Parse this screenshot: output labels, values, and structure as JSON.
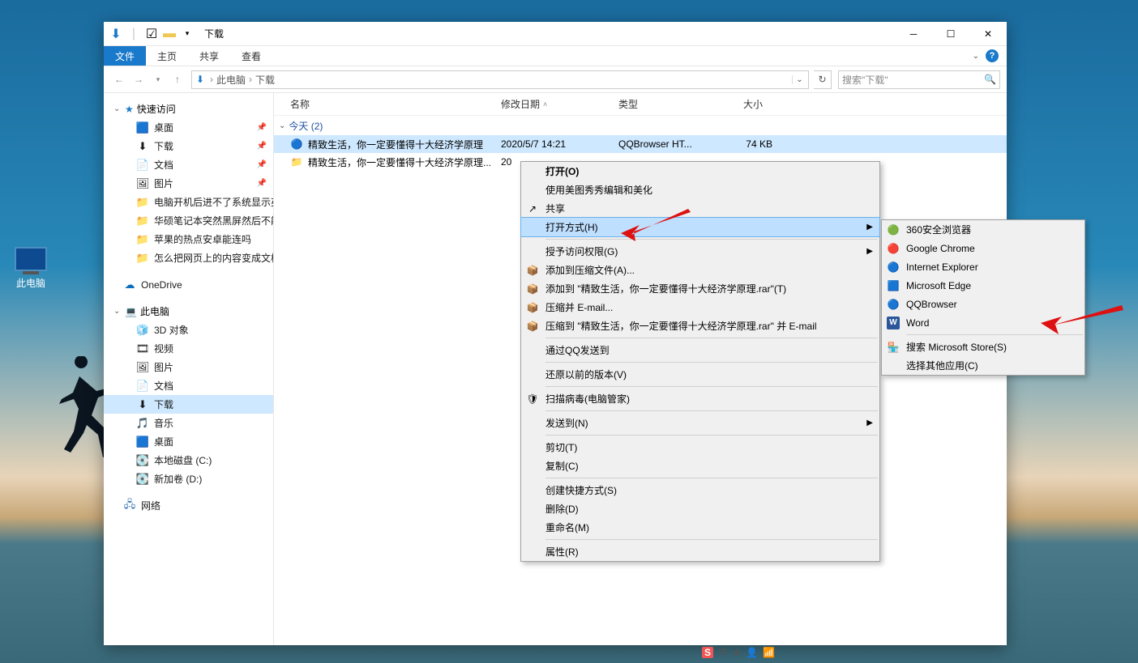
{
  "desktop": {
    "pc_label": "此电脑"
  },
  "titlebar": {
    "title": "下载"
  },
  "ribbon": {
    "file": "文件",
    "home": "主页",
    "share": "共享",
    "view": "查看"
  },
  "nav": {
    "crumbs": [
      "此电脑",
      "下载"
    ],
    "search_placeholder": "搜索\"下载\""
  },
  "sidebar": {
    "quick": {
      "label": "快速访问",
      "items": [
        {
          "label": "桌面",
          "icon": "🟦",
          "pin": true
        },
        {
          "label": "下载",
          "icon": "⬇",
          "pin": true
        },
        {
          "label": "文档",
          "icon": "📄",
          "pin": true
        },
        {
          "label": "图片",
          "icon": "🖼",
          "pin": true
        },
        {
          "label": "电脑开机后进不了系统显示英文",
          "icon": "📁"
        },
        {
          "label": "华硕笔记本突然黑屏然后不能开",
          "icon": "📁"
        },
        {
          "label": "苹果的热点安卓能连吗",
          "icon": "📁"
        },
        {
          "label": "怎么把网页上的内容变成文档",
          "icon": "📁"
        }
      ]
    },
    "onedrive": "OneDrive",
    "thispc": {
      "label": "此电脑",
      "items": [
        {
          "label": "3D 对象",
          "icon": "🧊"
        },
        {
          "label": "视频",
          "icon": "🎞"
        },
        {
          "label": "图片",
          "icon": "🖼"
        },
        {
          "label": "文档",
          "icon": "📄"
        },
        {
          "label": "下载",
          "icon": "⬇",
          "selected": true
        },
        {
          "label": "音乐",
          "icon": "🎵"
        },
        {
          "label": "桌面",
          "icon": "🟦"
        },
        {
          "label": "本地磁盘 (C:)",
          "icon": "💽"
        },
        {
          "label": "新加卷 (D:)",
          "icon": "💽"
        }
      ]
    },
    "network": "网络"
  },
  "columns": {
    "name": "名称",
    "date": "修改日期",
    "type": "类型",
    "size": "大小"
  },
  "group": {
    "label": "今天 (2)"
  },
  "files": [
    {
      "name": "精致生活，你一定要懂得十大经济学原理",
      "date": "2020/5/7 14:21",
      "type": "QQBrowser HT...",
      "size": "74 KB",
      "icon": "🔵",
      "selected": true
    },
    {
      "name": "精致生活，你一定要懂得十大经济学原理...",
      "date": "20",
      "type": "",
      "size": "",
      "icon": "📁"
    }
  ],
  "ctx": {
    "items": [
      {
        "t": "打开(O)",
        "bold": true
      },
      {
        "t": "使用美图秀秀编辑和美化"
      },
      {
        "t": "共享",
        "icon": "↗"
      },
      {
        "t": "打开方式(H)",
        "sub": true,
        "hl": true
      },
      {
        "sep": true
      },
      {
        "t": "授予访问权限(G)",
        "sub": true
      },
      {
        "t": "添加到压缩文件(A)...",
        "icon": "📦"
      },
      {
        "t": "添加到 \"精致生活，你一定要懂得十大经济学原理.rar\"(T)",
        "icon": "📦"
      },
      {
        "t": "压缩并 E-mail...",
        "icon": "📦"
      },
      {
        "t": "压缩到 \"精致生活，你一定要懂得十大经济学原理.rar\" 并 E-mail",
        "icon": "📦"
      },
      {
        "sep": true
      },
      {
        "t": "通过QQ发送到"
      },
      {
        "sep": true
      },
      {
        "t": "还原以前的版本(V)"
      },
      {
        "sep": true
      },
      {
        "t": "扫描病毒(电脑管家)",
        "icon": "🛡"
      },
      {
        "sep": true
      },
      {
        "t": "发送到(N)",
        "sub": true
      },
      {
        "sep": true
      },
      {
        "t": "剪切(T)"
      },
      {
        "t": "复制(C)"
      },
      {
        "sep": true
      },
      {
        "t": "创建快捷方式(S)"
      },
      {
        "t": "删除(D)"
      },
      {
        "t": "重命名(M)"
      },
      {
        "sep": true
      },
      {
        "t": "属性(R)"
      }
    ]
  },
  "submenu": {
    "items": [
      {
        "t": "360安全浏览器",
        "icon": "🟢"
      },
      {
        "t": "Google Chrome",
        "icon": "🔴"
      },
      {
        "t": "Internet Explorer",
        "icon": "🔵"
      },
      {
        "t": "Microsoft Edge",
        "icon": "🟦"
      },
      {
        "t": "QQBrowser",
        "icon": "🔵"
      },
      {
        "t": "Word",
        "icon": "W"
      },
      {
        "sep": true
      },
      {
        "t": "搜索 Microsoft Store(S)",
        "icon": "🏪"
      },
      {
        "t": "选择其他应用(C)"
      }
    ]
  },
  "tray_text": "中"
}
